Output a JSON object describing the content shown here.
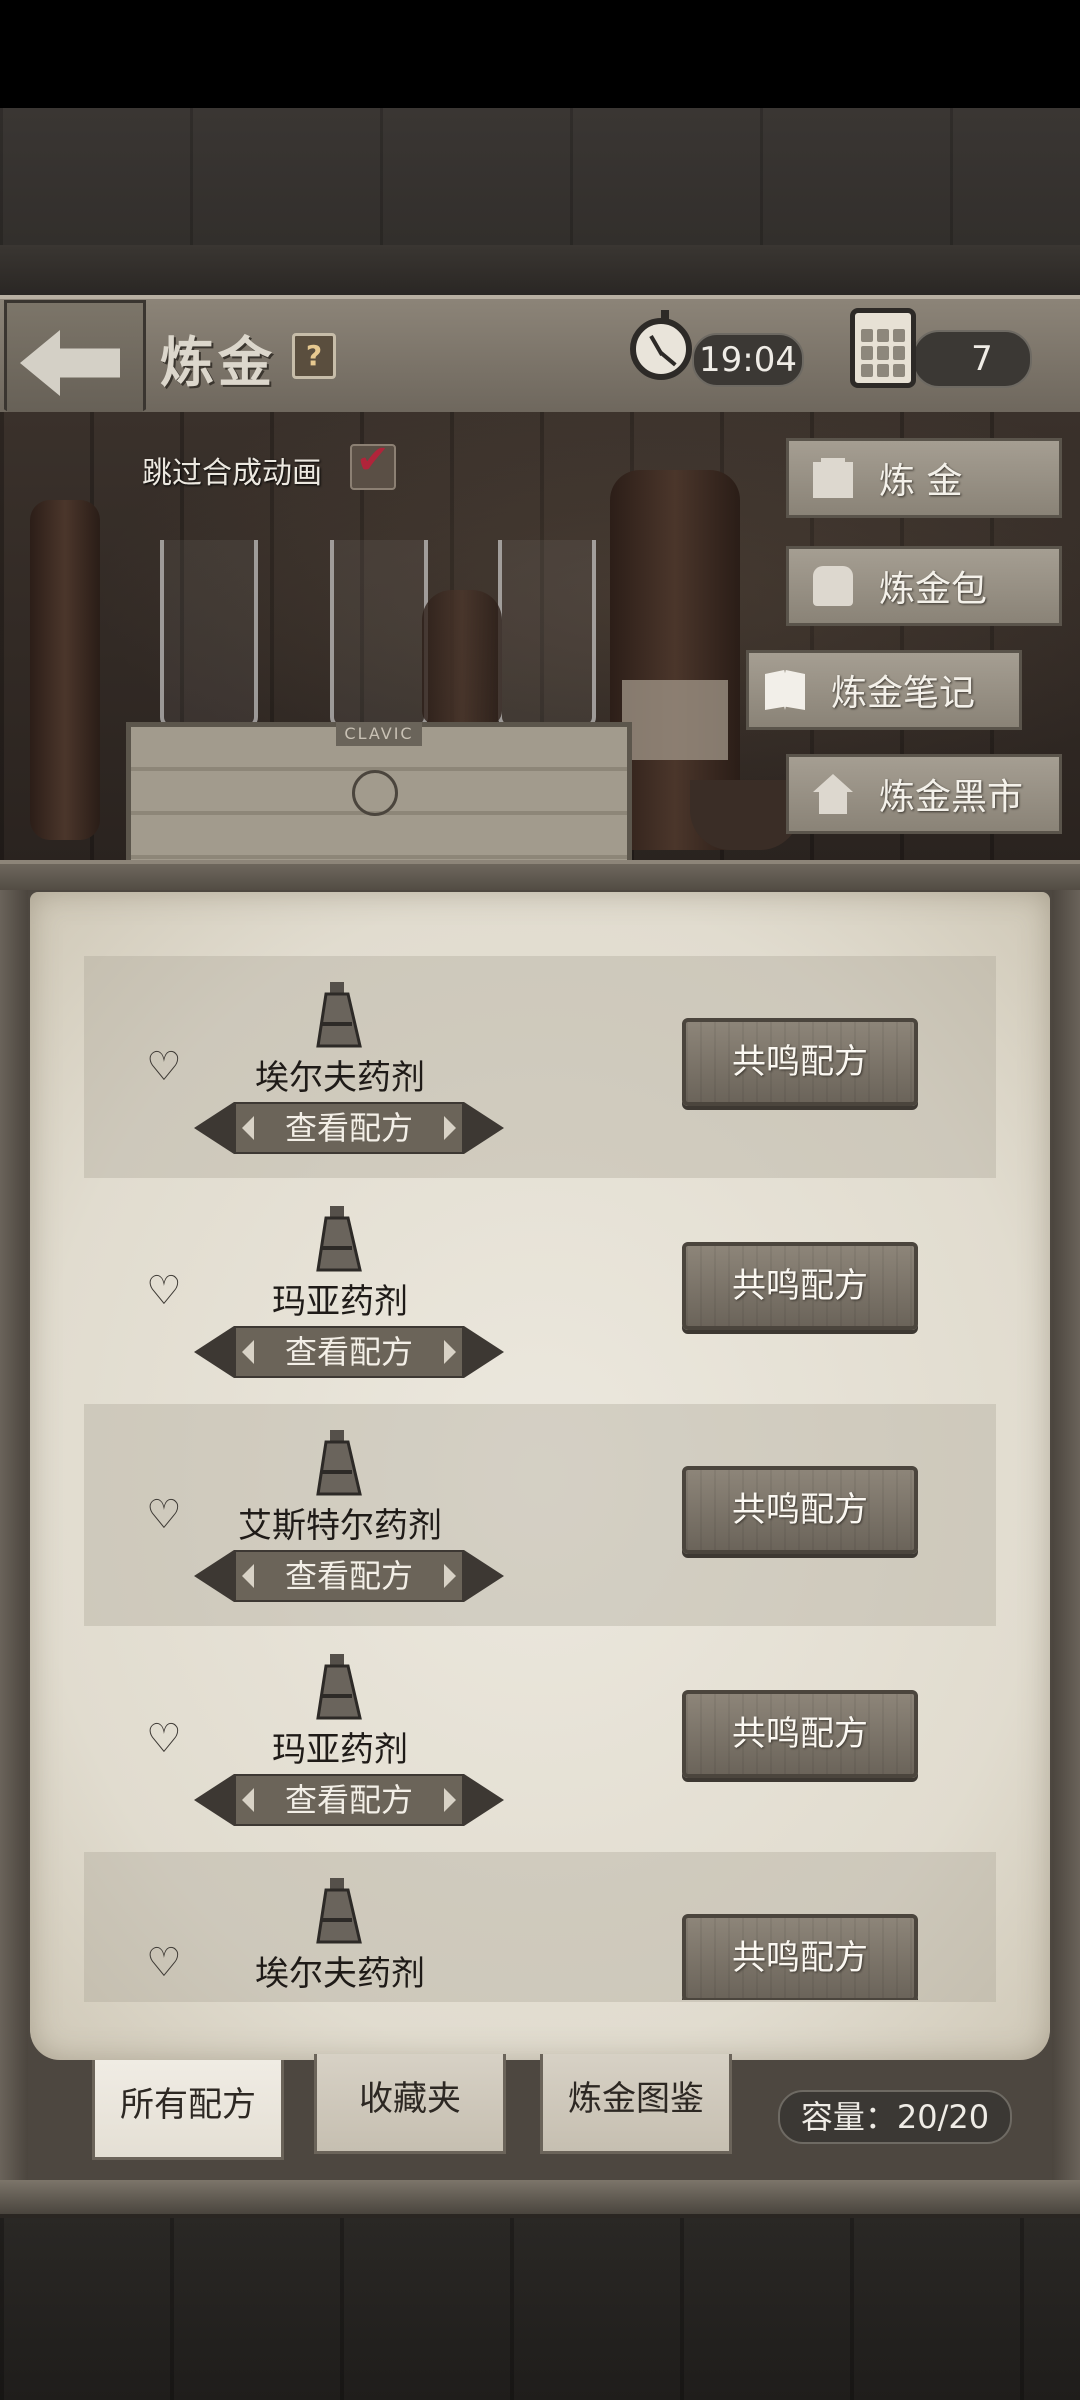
{
  "header": {
    "title": "炼金",
    "help_label": "?",
    "time": "19:04",
    "day": "7"
  },
  "scene": {
    "skip_animation_label": "跳过合成动画",
    "skip_animation_checked": true,
    "crate_text": "CLAVIC"
  },
  "side_menu": {
    "items": [
      {
        "label": "炼 金",
        "icon": "lantern-icon"
      },
      {
        "label": "炼金包",
        "icon": "backpack-icon"
      },
      {
        "label": "炼金笔记",
        "icon": "book-icon"
      },
      {
        "label": "炼金黑市",
        "icon": "house-icon"
      }
    ]
  },
  "recipes": {
    "view_label": "查看配方",
    "resonance_label": "共鸣配方",
    "items": [
      {
        "name": "埃尔夫药剂",
        "favorite": false
      },
      {
        "name": "玛亚药剂",
        "favorite": false
      },
      {
        "name": "艾斯特尔药剂",
        "favorite": false
      },
      {
        "name": "玛亚药剂",
        "favorite": false
      },
      {
        "name": "埃尔夫药剂",
        "favorite": false
      }
    ]
  },
  "tabs": {
    "items": [
      {
        "label": "所有配方",
        "active": true
      },
      {
        "label": "收藏夹",
        "active": false
      },
      {
        "label": "炼金图鉴",
        "active": false
      }
    ]
  },
  "capacity": {
    "text": "容量：20/20"
  },
  "colors": {
    "accent_check": "#b0243a",
    "pill_bg": "#3b3834",
    "parchment": "#e8e3d8"
  }
}
